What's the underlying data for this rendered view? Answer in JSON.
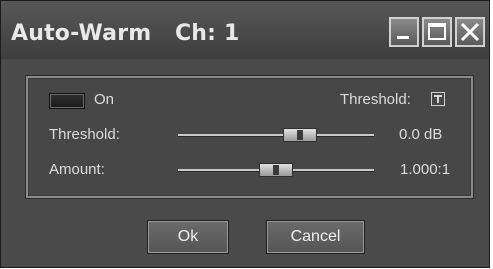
{
  "window": {
    "title": "Auto-Warm   Ch: 1",
    "controls": [
      "minimize-icon",
      "maximize-icon",
      "close-icon"
    ]
  },
  "panel": {
    "power_label": "On",
    "threshold_display_label": "Threshold:",
    "threshold_slider_label": "Threshold:",
    "threshold_value": "0.0 dB",
    "threshold_level": 0.62,
    "amount_label": "Amount:",
    "amount_value": "1.000:1",
    "amount_level": 0.5
  },
  "buttons": {
    "ok": "Ok",
    "cancel": "Cancel"
  }
}
